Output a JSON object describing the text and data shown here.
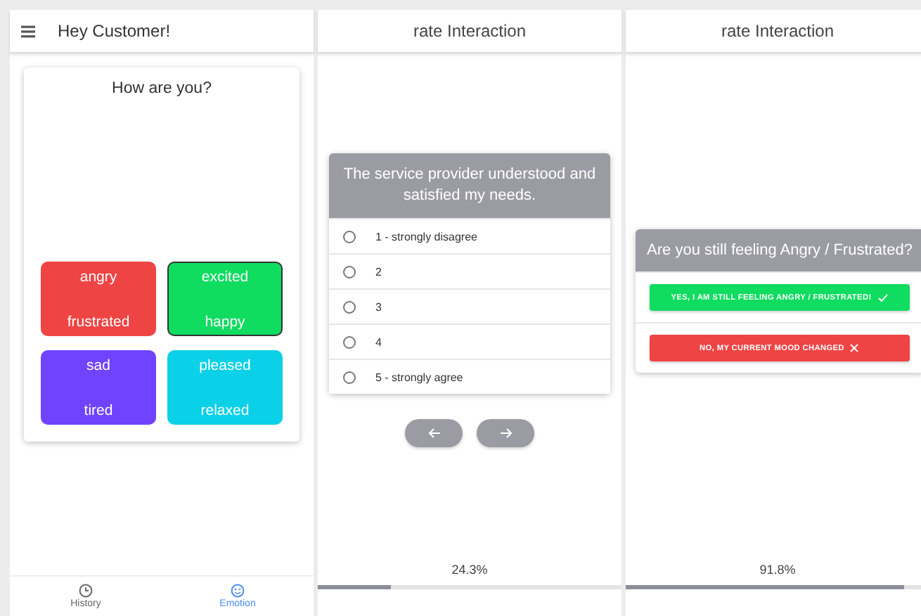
{
  "screens": [
    {
      "kind": "mood",
      "title": "Hey Customer!",
      "card": {
        "title": "How are you?",
        "moods": [
          {
            "top": "angry",
            "bottom": "frustrated",
            "color": "#ef4444",
            "selected": false
          },
          {
            "top": "excited",
            "bottom": "happy",
            "color": "#10dc60",
            "selected": true
          },
          {
            "top": "sad",
            "bottom": "tired",
            "color": "#7044ff",
            "selected": false
          },
          {
            "top": "pleased",
            "bottom": "relaxed",
            "color": "#0bd1e8",
            "selected": false
          }
        ]
      },
      "bottom_nav": [
        {
          "label": "History",
          "kind": "clock",
          "selected": false
        },
        {
          "label": "Emotion",
          "kind": "smiley",
          "selected": true
        }
      ]
    },
    {
      "kind": "rating",
      "title": "rate Interaction",
      "question": "The service provider understood and satisfied my needs.",
      "options": [
        {
          "label": "1 - strongly disagree",
          "selected": false
        },
        {
          "label": "2",
          "selected": false
        },
        {
          "label": "3",
          "selected": false
        },
        {
          "label": "4",
          "selected": false
        },
        {
          "label": "5 - strongly agree",
          "selected": false
        }
      ],
      "progress": {
        "reading": "24.3%",
        "level": 0.243
      }
    },
    {
      "kind": "confirm",
      "title": "rate Interaction",
      "question": "Are you still feeling Angry / Frustrated?",
      "buttons": [
        {
          "label": "YES, I AM STILL FEELING ANGRY / FRUSTRATED!",
          "kind": "yes"
        },
        {
          "label": "NO, MY CURRENT MOOD CHANGED",
          "kind": "no"
        }
      ],
      "progress": {
        "reading": "91.8%",
        "level": 0.918
      }
    }
  ]
}
